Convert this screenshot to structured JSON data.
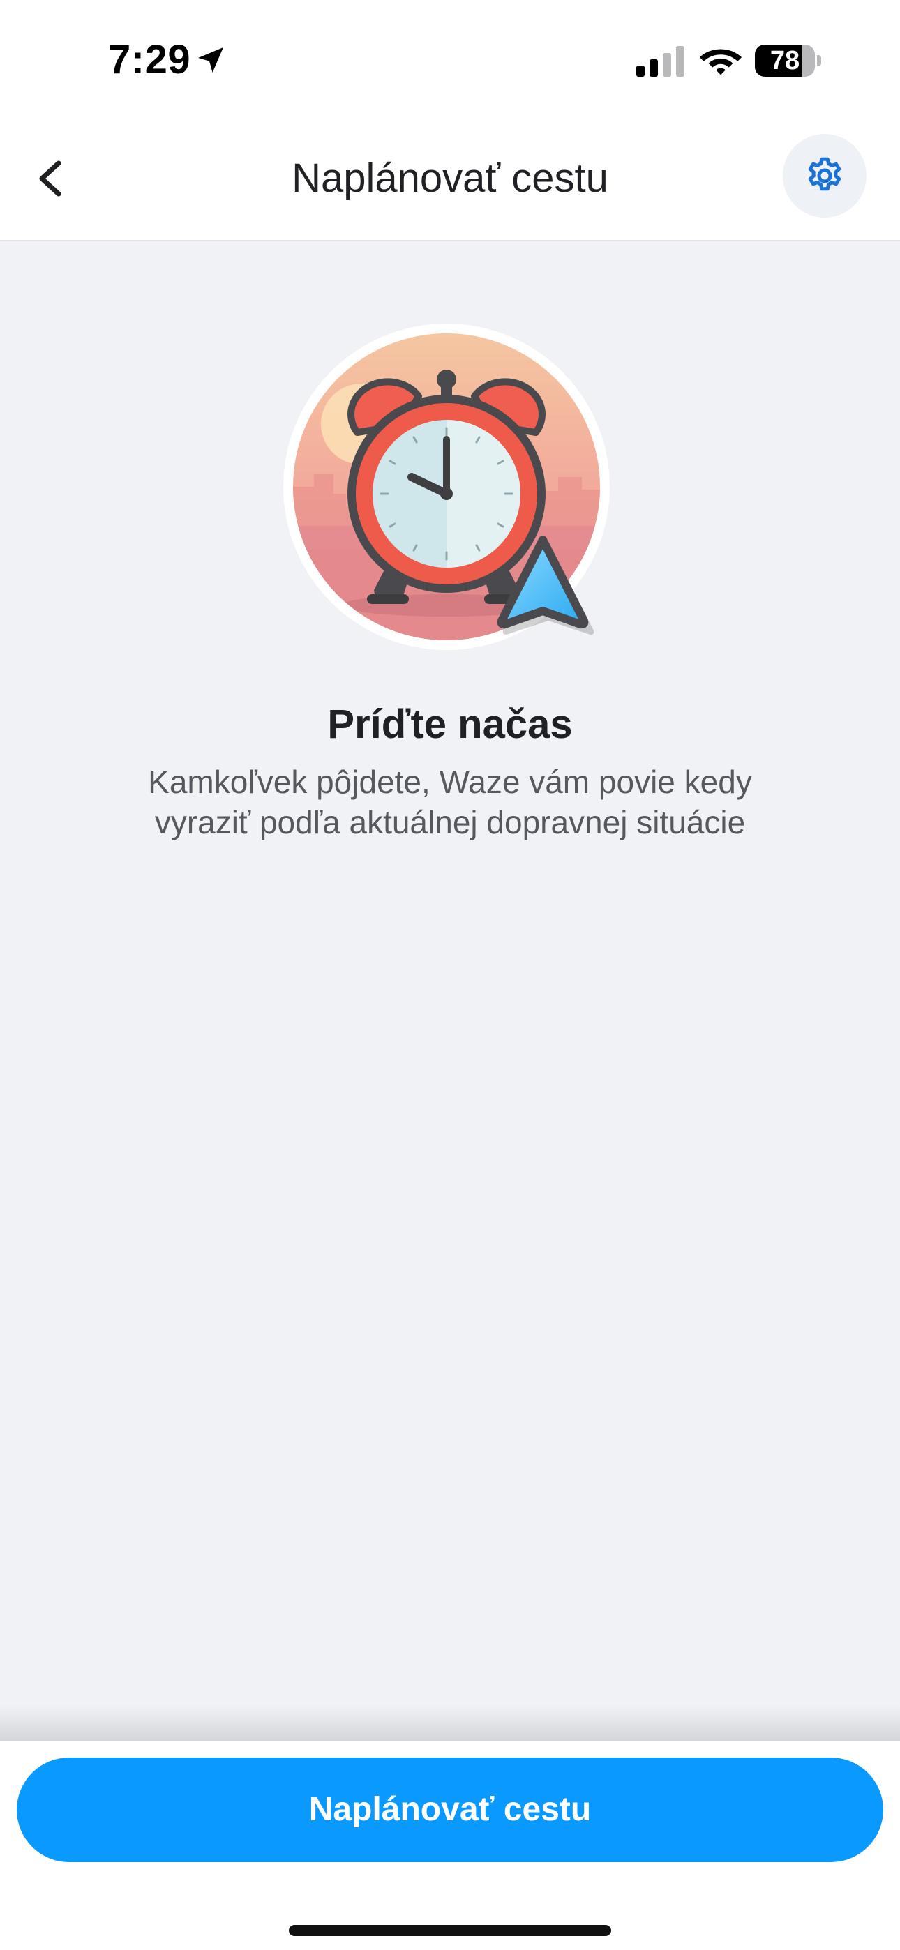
{
  "status_bar": {
    "time": "7:29",
    "battery_level": "78",
    "battery_fraction": 0.78,
    "icons": [
      "location-arrow-icon",
      "cellular-signal-icon",
      "wifi-icon",
      "battery-icon"
    ]
  },
  "header": {
    "title": "Naplánovať cestu",
    "back_icon": "chevron-left-icon",
    "settings_icon": "gear-icon"
  },
  "illustration": {
    "name": "alarm-clock-with-navigation-arrow",
    "clock_time": "10:00"
  },
  "content": {
    "heading": "Príďte načas",
    "description": "Kamkoľvek pôjdete, Waze vám povie kedy vyraziť podľa aktuálnej dopravnej situácie"
  },
  "footer": {
    "button_label": "Naplánovať cestu"
  },
  "colors": {
    "accent": "#0A99FF",
    "settings_icon": "#1A73D9",
    "background": "#F0F2F6",
    "title_text": "#202124",
    "body_text": "#55595F"
  }
}
